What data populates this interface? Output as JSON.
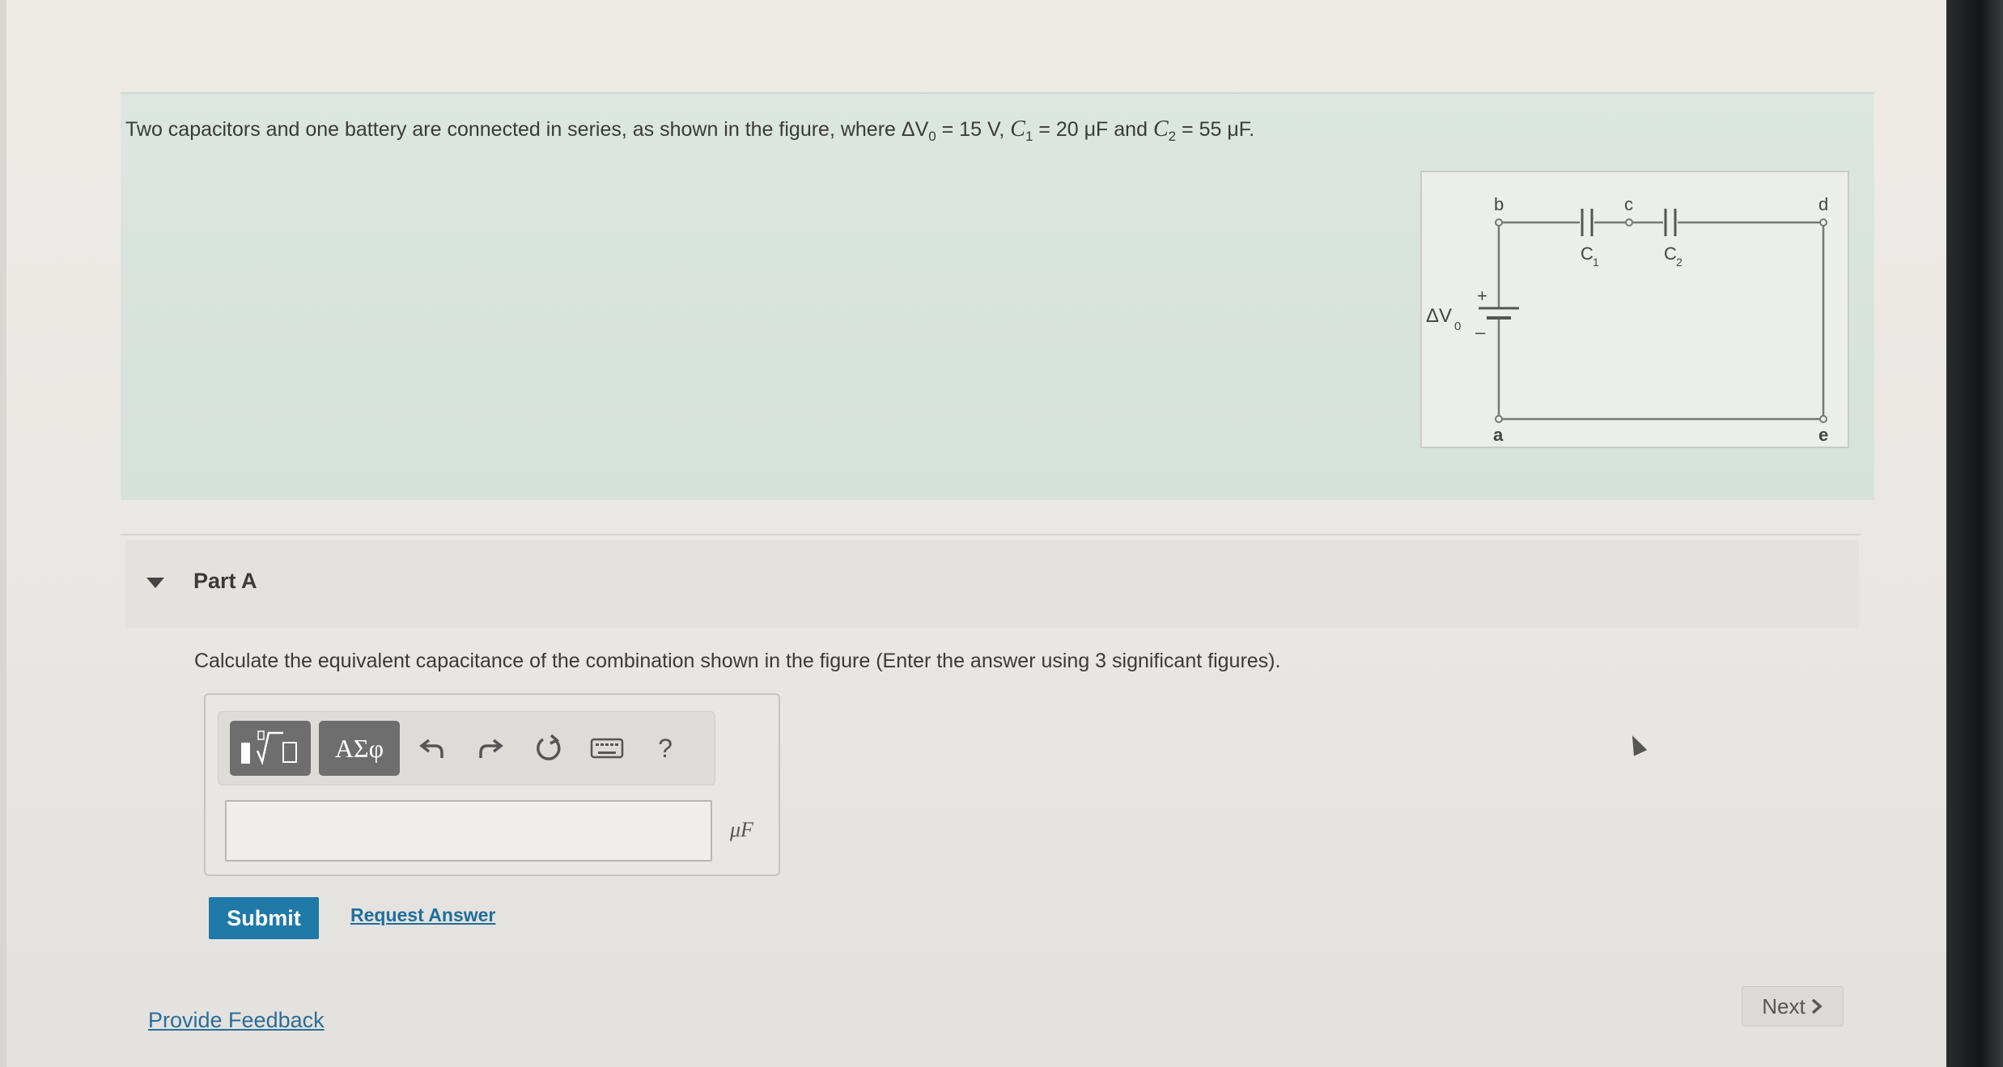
{
  "problem": {
    "text_before": "Two capacitors and one battery are connected in series, as shown in the figure, where ",
    "dv_symbol": "ΔV",
    "dv_sub": "0",
    "dv_value": " = 15 V, ",
    "c1_symbol": "C",
    "c1_sub": "1",
    "c1_value": " = 20 μF and ",
    "c2_symbol": "C",
    "c2_sub": "2",
    "c2_value": " = 55 μF."
  },
  "figure": {
    "node_b": "b",
    "node_c": "c",
    "node_d": "d",
    "node_a": "a",
    "node_e": "e",
    "cap1_label": "C",
    "cap1_sub": "1",
    "cap2_label": "C",
    "cap2_sub": "2",
    "battery_label": "ΔV",
    "battery_sub": "0",
    "plus": "+",
    "minus": "–"
  },
  "part": {
    "title": "Part A",
    "question": "Calculate the equivalent capacitance of the combination shown in the figure (Enter the answer using 3 significant figures).",
    "greek_button": "ΑΣφ",
    "help_button": "?",
    "answer_value": "",
    "unit": "μF",
    "submit_label": "Submit",
    "request_answer_label": "Request Answer"
  },
  "footer": {
    "feedback_label": "Provide Feedback",
    "next_label": "Next"
  },
  "colors": {
    "submit": "#1f7aa8",
    "link": "#1f6e9c",
    "problem_bg": "#d6e1da"
  }
}
